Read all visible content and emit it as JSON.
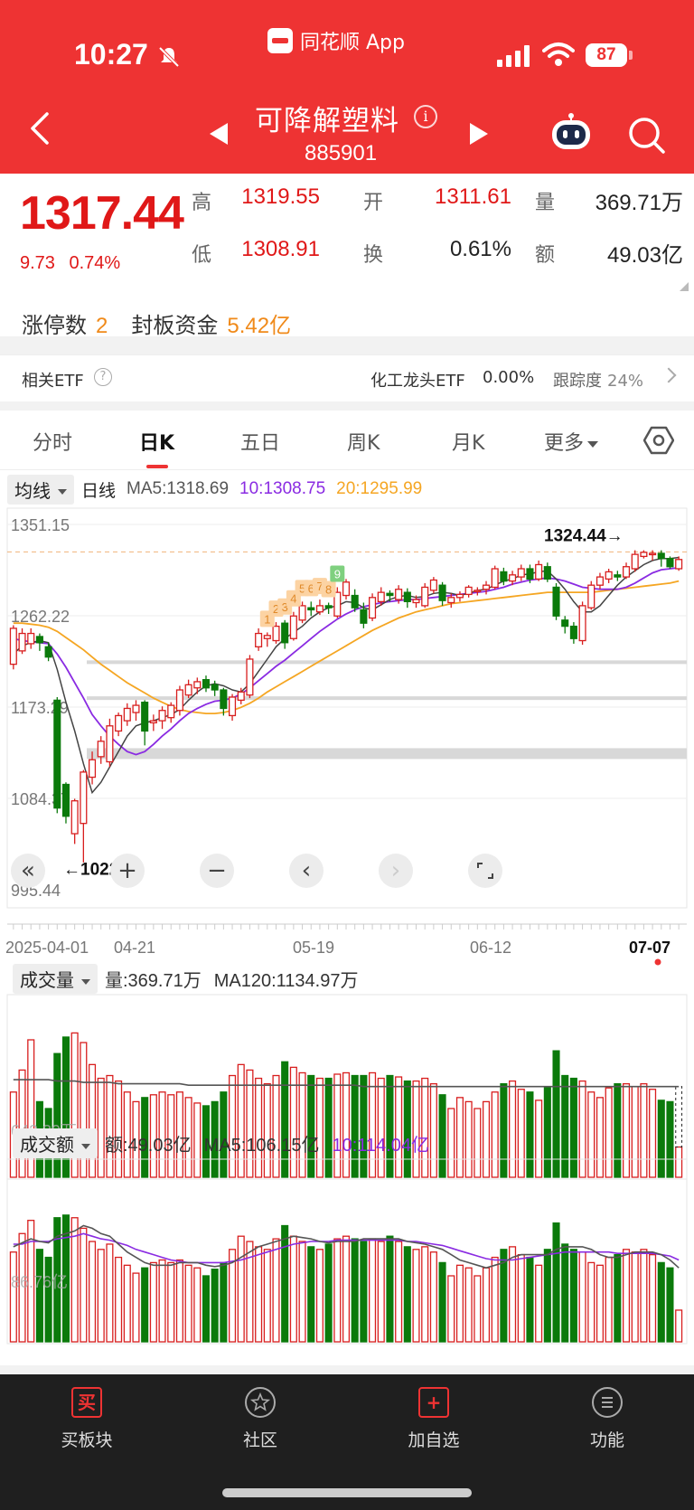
{
  "status": {
    "time": "10:27",
    "app_name": "同花顺 App",
    "battery": "87"
  },
  "header": {
    "stock_name": "可降解塑料",
    "stock_code": "885901"
  },
  "quote": {
    "price": "1317.44",
    "change": "9.73",
    "change_pct": "0.74%",
    "high_label": "高",
    "high": "1319.55",
    "open_label": "开",
    "open": "1311.61",
    "volume_label": "量",
    "volume": "369.71万",
    "low_label": "低",
    "low": "1308.91",
    "turnover_label": "换",
    "turnover": "0.61%",
    "amount_label": "额",
    "amount": "49.03亿",
    "limit_count_label": "涨停数",
    "limit_count": "2",
    "seal_fund_label": "封板资金",
    "seal_fund": "5.42亿"
  },
  "etf": {
    "label": "相关ETF",
    "help": "?",
    "name": "化工龙头ETF",
    "pct": "0.00%",
    "track_label": "跟踪度",
    "track": "24%"
  },
  "tabs": [
    {
      "label": "分时",
      "active": false
    },
    {
      "label": "日K",
      "active": true
    },
    {
      "label": "五日",
      "active": false
    },
    {
      "label": "周K",
      "active": false
    },
    {
      "label": "月K",
      "active": false
    },
    {
      "label": "更多",
      "active": false
    }
  ],
  "ma_bar": {
    "selector": "均线",
    "period": "日线",
    "ma5": "MA5:1318.69",
    "ma10": "10:1308.75",
    "ma20": "20:1295.99"
  },
  "volume_panel": {
    "selector": "成交量",
    "value": "量:369.71万",
    "ma": "MA120:1134.97万",
    "axis_label": "642.39万"
  },
  "amount_panel": {
    "selector": "成交额",
    "value": "额:49.03亿",
    "ma5": "MA5:106.15亿",
    "ma10": "10:114.04亿",
    "axis_label": "86.76亿"
  },
  "chart_data": {
    "type": "candlestick",
    "y_ticks": [
      "1351.15",
      "1262.22",
      "1173.29",
      "1084.37",
      "995.44"
    ],
    "x_labels": [
      "2025-04-01",
      "04-21",
      "05-19",
      "06-12",
      "07-07"
    ],
    "max_label": "1324.44→",
    "min_label": "←1022.14",
    "td_labels": [
      "1",
      "2",
      "3",
      "4",
      "5",
      "6",
      "7",
      "8",
      "9"
    ],
    "candles": [
      [
        1215,
        1250,
        1210,
        1253
      ],
      [
        1228,
        1245,
        1225,
        1250
      ],
      [
        1235,
        1245,
        1230,
        1250
      ],
      [
        1242,
        1236,
        1228,
        1245
      ],
      [
        1232,
        1222,
        1218,
        1236
      ],
      [
        1180,
        1075,
        1070,
        1183
      ],
      [
        1098,
        1067,
        1060,
        1100
      ],
      [
        1050,
        1082,
        1040,
        1084
      ],
      [
        1060,
        1110,
        1022,
        1112
      ],
      [
        1105,
        1122,
        1098,
        1130
      ],
      [
        1125,
        1140,
        1118,
        1145
      ],
      [
        1120,
        1155,
        1115,
        1162
      ],
      [
        1150,
        1165,
        1145,
        1168
      ],
      [
        1160,
        1172,
        1155,
        1177
      ],
      [
        1168,
        1175,
        1160,
        1180
      ],
      [
        1178,
        1150,
        1136,
        1180
      ],
      [
        1158,
        1160,
        1150,
        1166
      ],
      [
        1160,
        1170,
        1152,
        1174
      ],
      [
        1163,
        1175,
        1158,
        1178
      ],
      [
        1170,
        1190,
        1165,
        1194
      ],
      [
        1185,
        1195,
        1182,
        1200
      ],
      [
        1192,
        1198,
        1186,
        1202
      ],
      [
        1200,
        1192,
        1188,
        1204
      ],
      [
        1195,
        1190,
        1184,
        1199
      ],
      [
        1190,
        1172,
        1165,
        1192
      ],
      [
        1165,
        1183,
        1160,
        1186
      ],
      [
        1180,
        1188,
        1176,
        1192
      ],
      [
        1185,
        1220,
        1182,
        1224
      ],
      [
        1232,
        1245,
        1228,
        1250
      ],
      [
        1240,
        1243,
        1232,
        1246
      ],
      [
        1238,
        1252,
        1235,
        1256
      ],
      [
        1255,
        1236,
        1230,
        1258
      ],
      [
        1240,
        1262,
        1238,
        1266
      ],
      [
        1258,
        1272,
        1255,
        1276
      ],
      [
        1270,
        1268,
        1262,
        1276
      ],
      [
        1266,
        1272,
        1263,
        1278
      ],
      [
        1272,
        1270,
        1264,
        1275
      ],
      [
        1262,
        1285,
        1260,
        1290
      ],
      [
        1282,
        1295,
        1278,
        1298
      ],
      [
        1282,
        1270,
        1266,
        1288
      ],
      [
        1268,
        1255,
        1250,
        1275
      ],
      [
        1260,
        1280,
        1257,
        1284
      ],
      [
        1276,
        1285,
        1272,
        1290
      ],
      [
        1284,
        1282,
        1276,
        1287
      ],
      [
        1278,
        1288,
        1274,
        1292
      ],
      [
        1285,
        1276,
        1270,
        1289
      ],
      [
        1275,
        1278,
        1270,
        1282
      ],
      [
        1272,
        1290,
        1270,
        1294
      ],
      [
        1287,
        1297,
        1284,
        1300
      ],
      [
        1292,
        1277,
        1272,
        1295
      ],
      [
        1275,
        1280,
        1270,
        1284
      ],
      [
        1280,
        1283,
        1276,
        1286
      ],
      [
        1283,
        1290,
        1280,
        1292
      ],
      [
        1286,
        1287,
        1282,
        1290
      ],
      [
        1288,
        1292,
        1283,
        1296
      ],
      [
        1290,
        1308,
        1288,
        1311
      ],
      [
        1305,
        1296,
        1292,
        1309
      ],
      [
        1296,
        1302,
        1292,
        1306
      ],
      [
        1300,
        1308,
        1296,
        1312
      ],
      [
        1308,
        1298,
        1294,
        1312
      ],
      [
        1298,
        1312,
        1296,
        1316
      ],
      [
        1310,
        1298,
        1295,
        1314
      ],
      [
        1290,
        1262,
        1258,
        1294
      ],
      [
        1258,
        1252,
        1245,
        1262
      ],
      [
        1252,
        1240,
        1235,
        1256
      ],
      [
        1238,
        1272,
        1234,
        1276
      ],
      [
        1270,
        1292,
        1268,
        1296
      ],
      [
        1292,
        1300,
        1288,
        1304
      ],
      [
        1298,
        1305,
        1294,
        1308
      ],
      [
        1302,
        1300,
        1296,
        1306
      ],
      [
        1300,
        1310,
        1298,
        1314
      ],
      [
        1308,
        1322,
        1305,
        1326
      ],
      [
        1320,
        1324,
        1318,
        1326
      ],
      [
        1322,
        1323,
        1316,
        1326
      ],
      [
        1323,
        1318,
        1310,
        1326
      ],
      [
        1318,
        1310,
        1308,
        1320
      ],
      [
        1308,
        1317,
        1306,
        1320
      ]
    ],
    "ma5": [
      1225,
      1233,
      1236,
      1238,
      1236,
      1210,
      1178,
      1150,
      1118,
      1090,
      1100,
      1115,
      1130,
      1145,
      1155,
      1158,
      1160,
      1163,
      1166,
      1171,
      1180,
      1188,
      1194,
      1196,
      1194,
      1190,
      1188,
      1196,
      1208,
      1220,
      1232,
      1240,
      1246,
      1252,
      1260,
      1266,
      1270,
      1272,
      1276,
      1275,
      1270,
      1268,
      1273,
      1278,
      1281,
      1282,
      1280,
      1281,
      1284,
      1285,
      1284,
      1282,
      1284,
      1287,
      1288,
      1292,
      1296,
      1298,
      1302,
      1303,
      1305,
      1306,
      1298,
      1288,
      1276,
      1266,
      1266,
      1272,
      1282,
      1292,
      1300,
      1306,
      1312,
      1316,
      1318,
      1318,
      1319
    ],
    "ma10": [
      1240,
      1238,
      1237,
      1236,
      1235,
      1225,
      1212,
      1197,
      1182,
      1166,
      1155,
      1145,
      1137,
      1130,
      1127,
      1130,
      1137,
      1145,
      1152,
      1160,
      1167,
      1172,
      1176,
      1179,
      1180,
      1182,
      1186,
      1192,
      1199,
      1206,
      1213,
      1219,
      1226,
      1233,
      1240,
      1247,
      1253,
      1259,
      1264,
      1268,
      1271,
      1273,
      1275,
      1276,
      1277,
      1278,
      1278,
      1279,
      1280,
      1281,
      1282,
      1283,
      1284,
      1285,
      1286,
      1288,
      1290,
      1293,
      1295,
      1297,
      1298,
      1299,
      1298,
      1296,
      1293,
      1290,
      1289,
      1288,
      1288,
      1288,
      1290,
      1294,
      1299,
      1304,
      1307,
      1308,
      1309
    ],
    "ma20": [
      1255,
      1255,
      1254,
      1253,
      1251,
      1247,
      1241,
      1235,
      1229,
      1222,
      1215,
      1209,
      1203,
      1197,
      1192,
      1187,
      1182,
      1178,
      1174,
      1171,
      1169,
      1168,
      1167,
      1167,
      1168,
      1170,
      1173,
      1177,
      1182,
      1188,
      1193,
      1198,
      1203,
      1208,
      1213,
      1218,
      1223,
      1228,
      1233,
      1238,
      1243,
      1248,
      1252,
      1256,
      1260,
      1263,
      1266,
      1268,
      1270,
      1272,
      1274,
      1275,
      1276,
      1277,
      1278,
      1279,
      1280,
      1281,
      1282,
      1283,
      1284,
      1285,
      1285,
      1285,
      1285,
      1285,
      1285,
      1286,
      1287,
      1288,
      1289,
      1290,
      1291,
      1292,
      1293,
      1294,
      1296
    ],
    "volume": [
      0.62,
      0.78,
      1.0,
      0.55,
      0.5,
      0.9,
      1.02,
      1.05,
      0.98,
      0.82,
      0.72,
      0.74,
      0.7,
      0.62,
      0.55,
      0.58,
      0.6,
      0.62,
      0.6,
      0.62,
      0.58,
      0.54,
      0.52,
      0.55,
      0.62,
      0.74,
      0.82,
      0.78,
      0.72,
      0.68,
      0.74,
      0.84,
      0.8,
      0.76,
      0.74,
      0.72,
      0.72,
      0.75,
      0.76,
      0.74,
      0.74,
      0.76,
      0.72,
      0.74,
      0.73,
      0.7,
      0.7,
      0.72,
      0.68,
      0.6,
      0.5,
      0.58,
      0.55,
      0.5,
      0.55,
      0.62,
      0.68,
      0.7,
      0.64,
      0.62,
      0.56,
      0.66,
      0.92,
      0.74,
      0.72,
      0.7,
      0.62,
      0.58,
      0.65,
      0.68,
      0.68,
      0.66,
      0.68,
      0.64,
      0.56,
      0.55,
      0.22
    ],
    "volume_ma": [
      0.71,
      0.71,
      0.71,
      0.71,
      0.71,
      0.7,
      0.7,
      0.7,
      0.69,
      0.69,
      0.69,
      0.69,
      0.68,
      0.68,
      0.68,
      0.68,
      0.68,
      0.68,
      0.68,
      0.68,
      0.67,
      0.67,
      0.67,
      0.67,
      0.67,
      0.67,
      0.67,
      0.67,
      0.67,
      0.67,
      0.67,
      0.67,
      0.67,
      0.67,
      0.67,
      0.67,
      0.67,
      0.67,
      0.67,
      0.67,
      0.66,
      0.66,
      0.66,
      0.66,
      0.66,
      0.66,
      0.66,
      0.66,
      0.66,
      0.66,
      0.66,
      0.66,
      0.66,
      0.66,
      0.66,
      0.66,
      0.66,
      0.66,
      0.66,
      0.66,
      0.66,
      0.66,
      0.66,
      0.66,
      0.66,
      0.66,
      0.66,
      0.66,
      0.66,
      0.66,
      0.66,
      0.66,
      0.66,
      0.66,
      0.66,
      0.66,
      0.66
    ],
    "amount": [
      0.68,
      0.82,
      0.92,
      0.7,
      0.64,
      0.94,
      0.96,
      0.94,
      0.86,
      0.76,
      0.7,
      0.74,
      0.64,
      0.58,
      0.52,
      0.56,
      0.6,
      0.62,
      0.6,
      0.62,
      0.58,
      0.56,
      0.5,
      0.55,
      0.6,
      0.7,
      0.8,
      0.76,
      0.72,
      0.7,
      0.78,
      0.88,
      0.8,
      0.76,
      0.72,
      0.7,
      0.74,
      0.78,
      0.8,
      0.78,
      0.76,
      0.78,
      0.76,
      0.8,
      0.76,
      0.72,
      0.7,
      0.72,
      0.68,
      0.6,
      0.5,
      0.58,
      0.56,
      0.5,
      0.56,
      0.64,
      0.7,
      0.72,
      0.66,
      0.64,
      0.58,
      0.7,
      0.9,
      0.74,
      0.7,
      0.68,
      0.6,
      0.58,
      0.64,
      0.66,
      0.7,
      0.68,
      0.7,
      0.66,
      0.6,
      0.56,
      0.24
    ],
    "amount_ma5": [
      0.72,
      0.75,
      0.78,
      0.76,
      0.75,
      0.8,
      0.82,
      0.84,
      0.88,
      0.86,
      0.82,
      0.8,
      0.74,
      0.68,
      0.64,
      0.6,
      0.58,
      0.58,
      0.58,
      0.6,
      0.6,
      0.6,
      0.58,
      0.57,
      0.58,
      0.6,
      0.64,
      0.68,
      0.72,
      0.74,
      0.76,
      0.78,
      0.8,
      0.79,
      0.78,
      0.76,
      0.75,
      0.76,
      0.76,
      0.76,
      0.78,
      0.78,
      0.78,
      0.78,
      0.78,
      0.76,
      0.75,
      0.74,
      0.72,
      0.7,
      0.66,
      0.62,
      0.6,
      0.58,
      0.56,
      0.58,
      0.6,
      0.64,
      0.66,
      0.66,
      0.66,
      0.66,
      0.7,
      0.72,
      0.72,
      0.72,
      0.7,
      0.66,
      0.64,
      0.64,
      0.66,
      0.68,
      0.68,
      0.68,
      0.66,
      0.62,
      0.56
    ],
    "amount_ma10": [
      0.74,
      0.74,
      0.76,
      0.76,
      0.76,
      0.78,
      0.79,
      0.8,
      0.82,
      0.8,
      0.78,
      0.77,
      0.75,
      0.73,
      0.7,
      0.68,
      0.66,
      0.64,
      0.62,
      0.61,
      0.6,
      0.6,
      0.6,
      0.6,
      0.6,
      0.61,
      0.62,
      0.64,
      0.66,
      0.68,
      0.7,
      0.72,
      0.74,
      0.75,
      0.76,
      0.76,
      0.76,
      0.77,
      0.77,
      0.77,
      0.77,
      0.77,
      0.77,
      0.77,
      0.77,
      0.76,
      0.76,
      0.75,
      0.74,
      0.73,
      0.71,
      0.69,
      0.67,
      0.65,
      0.63,
      0.62,
      0.62,
      0.62,
      0.63,
      0.64,
      0.65,
      0.66,
      0.67,
      0.68,
      0.68,
      0.68,
      0.68,
      0.68,
      0.68,
      0.67,
      0.67,
      0.67,
      0.67,
      0.67,
      0.66,
      0.65,
      0.62
    ]
  },
  "bottom_nav": [
    {
      "label": "买板块",
      "icon": "buy-icon",
      "glyph": "买"
    },
    {
      "label": "社区",
      "icon": "community-icon",
      "glyph": ""
    },
    {
      "label": "加自选",
      "icon": "add-watchlist-icon",
      "glyph": "+"
    },
    {
      "label": "功能",
      "icon": "menu-icon",
      "glyph": ""
    }
  ]
}
